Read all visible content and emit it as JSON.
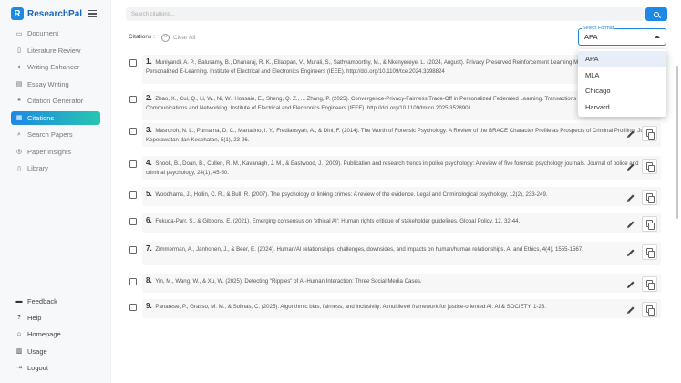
{
  "app": {
    "name": "ResearchPal"
  },
  "sidebar": {
    "items": [
      {
        "label": "Document",
        "icon": "document-icon"
      },
      {
        "label": "Literature Review",
        "icon": "book-icon"
      },
      {
        "label": "Writing Enhancer",
        "icon": "sparkle-icon"
      },
      {
        "label": "Essay Writing",
        "icon": "essay-icon"
      },
      {
        "label": "Citation Generator",
        "icon": "quote-icon"
      },
      {
        "label": "Citations",
        "icon": "citations-icon",
        "active": true
      },
      {
        "label": "Search Papers",
        "icon": "search-icon"
      },
      {
        "label": "Paper Insights",
        "icon": "insights-icon"
      },
      {
        "label": "Library",
        "icon": "library-icon"
      }
    ],
    "bottom": [
      {
        "label": "Feedback",
        "icon": "feedback-icon"
      },
      {
        "label": "Help",
        "icon": "help-icon"
      },
      {
        "label": "Homepage",
        "icon": "home-icon"
      },
      {
        "label": "Usage",
        "icon": "usage-icon"
      },
      {
        "label": "Logout",
        "icon": "logout-icon"
      }
    ]
  },
  "search": {
    "placeholder": "Search citations..."
  },
  "toolbar": {
    "citations_label": "Citations :",
    "clear_all": "Clear All"
  },
  "format": {
    "label": "Select Format",
    "selected": "APA",
    "options": [
      "APA",
      "MLA",
      "Chicago",
      "Harvard"
    ]
  },
  "citations": [
    {
      "num": "1.",
      "text": "Muniyandi, A. P., Balusamy, B., Dhanaraj, R. K., Ellappan, V., Murali, S., Sathyamoorthy, M., & Nkenyereye, L. (2024, August). Privacy Preserved Reinforcement Learning Model Using Generative AI for Personalized E-Learning. Institute of Electrical and Electronics Engineers (IEEE). http://doi.org/10.1109/tce.2024.3398824"
    },
    {
      "num": "2.",
      "text": "Zhao, X., Cui, Q., Li, W., Ni, W., Hossain, E., Sheng, Q. Z., ... Zhang, P. (2025). Convergence-Privacy-Fairness Trade-Off in Personalized Federated Learning. Transactions on Machine Learning in Communications and Networking. Institute of Electrical and Electronics Engineers (IEEE). http://doi.org/10.1109/tmlcn.2025.3528901"
    },
    {
      "num": "3.",
      "text": "Masruroh, N. L., Purnama, D. C., Martatino, I. Y., Frediansyah, A., & Dini, F. (2014). The Worth of Forensic Psychology: A Review of the BRACE Character Profile as Prospects of Criminal Profiling. Jurnal Keperawatan dan Kesehatan, 5(1), 23-26."
    },
    {
      "num": "4.",
      "text": "Snook, B., Doan, B., Cullen, R. M., Kavanagh, J. M., & Eastwood, J. (2009). Publication and research trends in police psychology: A review of five forensic psychology journals. Journal of police and criminal psychology, 24(1), 45-50."
    },
    {
      "num": "5.",
      "text": "Woodhams, J., Hollin, C. R., & Bull, R. (2007). The psychology of linking crimes: A review of the evidence. Legal and Criminological psychology, 12(2), 233-249."
    },
    {
      "num": "6.",
      "text": "Fukuda-Parr, S., & Gibbons, E. (2021). Emerging consensus on 'ethical AI': Human rights critique of stakeholder guidelines. Global Policy, 12, 32-44."
    },
    {
      "num": "7.",
      "text": "Zimmerman, A., Janhonen, J., & Beer, E. (2024). Human/AI relationships: challenges, downsides, and impacts on human/human relationships. AI and Ethics, 4(4), 1555-1567."
    },
    {
      "num": "8.",
      "text": "Yin, M., Wang, W., & Xu, W. (2025). Detecting \"Ripples\" of AI-Human Interaction: Three Social Media Cases."
    },
    {
      "num": "9.",
      "text": "Panarese, P., Grasso, M. M., & Solinas, C. (2025). Algorithmic bias, fairness, and inclusivity: A multilevel framework for justice-oriented AI. AI & SOCIETY, 1-23."
    }
  ],
  "colors": {
    "accent": "#1e88e5",
    "active_gradient_end": "#26c6b0"
  }
}
